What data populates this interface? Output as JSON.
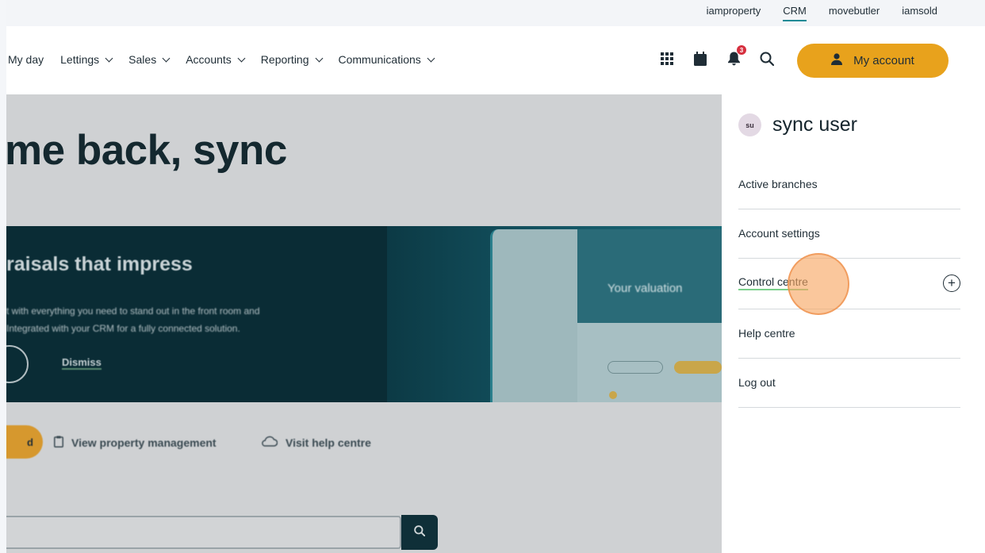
{
  "brands": [
    "iamproperty",
    "CRM",
    "movebutler",
    "iamsold"
  ],
  "active_brand_index": 1,
  "nav": {
    "items": [
      {
        "label": "My day",
        "dropdown": false
      },
      {
        "label": "Lettings",
        "dropdown": true
      },
      {
        "label": "Sales",
        "dropdown": true
      },
      {
        "label": "Accounts",
        "dropdown": true
      },
      {
        "label": "Reporting",
        "dropdown": true
      },
      {
        "label": "Communications",
        "dropdown": true
      }
    ],
    "icons": [
      "apps-grid-icon",
      "calendar-icon",
      "bell-icon",
      "search-icon"
    ],
    "notification_count": "3",
    "account_label": "My account"
  },
  "main": {
    "welcome": "me back, sync",
    "banner": {
      "title": "raisals that impress",
      "text_line1": "t with everything you need to stand out in the front room and",
      "text_line2": "Integrated with your CRM for a fully connected solution.",
      "dismiss": "Dismiss",
      "mock_title": "Your valuation"
    },
    "actions": {
      "primary_label": "d",
      "link1": "View property management",
      "link2": "Visit help centre"
    }
  },
  "panel": {
    "initials": "su",
    "user_name": "sync user",
    "items": [
      {
        "label": "Active branches"
      },
      {
        "label": "Account settings"
      },
      {
        "label": "Control centre",
        "expandable": true
      },
      {
        "label": "Help centre"
      },
      {
        "label": "Log out"
      }
    ]
  },
  "colors": {
    "accent": "#e8a21c",
    "brand_underline": "#1f8a96",
    "badge": "#d6303f",
    "banner": "#0a2c35"
  }
}
